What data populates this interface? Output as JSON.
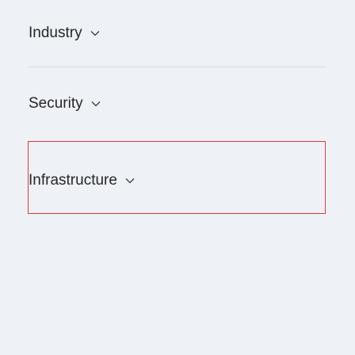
{
  "menu": {
    "items": [
      {
        "label": "Industry",
        "icon": "chevron-down-icon"
      },
      {
        "label": "Security",
        "icon": "chevron-down-icon"
      },
      {
        "label": "Infrastructure",
        "icon": "chevron-down-icon"
      }
    ]
  },
  "colors": {
    "background": "#eef1f6",
    "text": "#262626",
    "divider": "#d6d9de",
    "focus_outline": "#d93a3a"
  }
}
